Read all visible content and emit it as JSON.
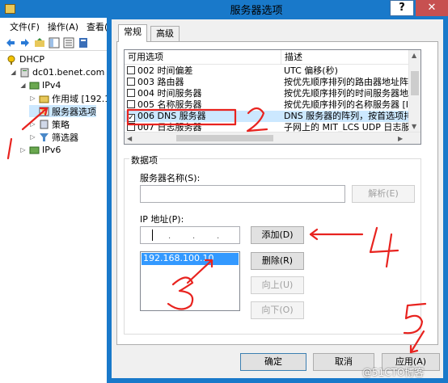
{
  "mmc": {
    "menu": [
      "文件(F)",
      "操作(A)",
      "查看(V"
    ],
    "tree": {
      "root": "DHCP",
      "server": "dc01.benet.com",
      "ipv4": "IPv4",
      "scope": "作用域 [192.1",
      "server_options": "服务器选项",
      "policies": "策略",
      "filters": "筛选器",
      "ipv6": "IPv6"
    }
  },
  "dialog": {
    "title": "服务器选项",
    "help": "?",
    "close": "✕",
    "tabs": [
      "常规",
      "高级"
    ],
    "list": {
      "col_available": "可用选项",
      "col_description": "描述",
      "rows": [
        {
          "checked": false,
          "option": "002 时间偏差",
          "desc": "UTC 偏移(秒)"
        },
        {
          "checked": false,
          "option": "003 路由器",
          "desc": "按优先顺序排列的路由器地址阵列"
        },
        {
          "checked": false,
          "option": "004 时间服务器",
          "desc": "按优先顺序排列的时间服务器地址"
        },
        {
          "checked": false,
          "option": "005 名称服务器",
          "desc": "按优先顺序排列的名称服务器 [IEN"
        },
        {
          "checked": true,
          "option": "006 DNS 服务器",
          "desc": "DNS 服务器的阵列，按首选项排列"
        },
        {
          "checked": false,
          "option": "007 日志服务器",
          "desc": "子网上的 MIT_LCS UDP 日志服务器"
        }
      ]
    },
    "data_group": "数据项",
    "server_name_label": "服务器名称(S):",
    "server_name_value": "",
    "resolve_button": "解析(E)",
    "ip_label": "IP 地址(P):",
    "add_button": "添加(D)",
    "remove_button": "删除(R)",
    "up_button": "向上(U)",
    "down_button": "向下(O)",
    "ip_entries": [
      "192.168.100.10"
    ],
    "ok_button": "确定",
    "cancel_button": "取消",
    "apply_button": "应用(A)"
  },
  "annotations": {
    "color": "#e8231f",
    "marks": [
      "1",
      "2",
      "3",
      "4",
      "5"
    ]
  },
  "watermark": "@51CTO博客"
}
